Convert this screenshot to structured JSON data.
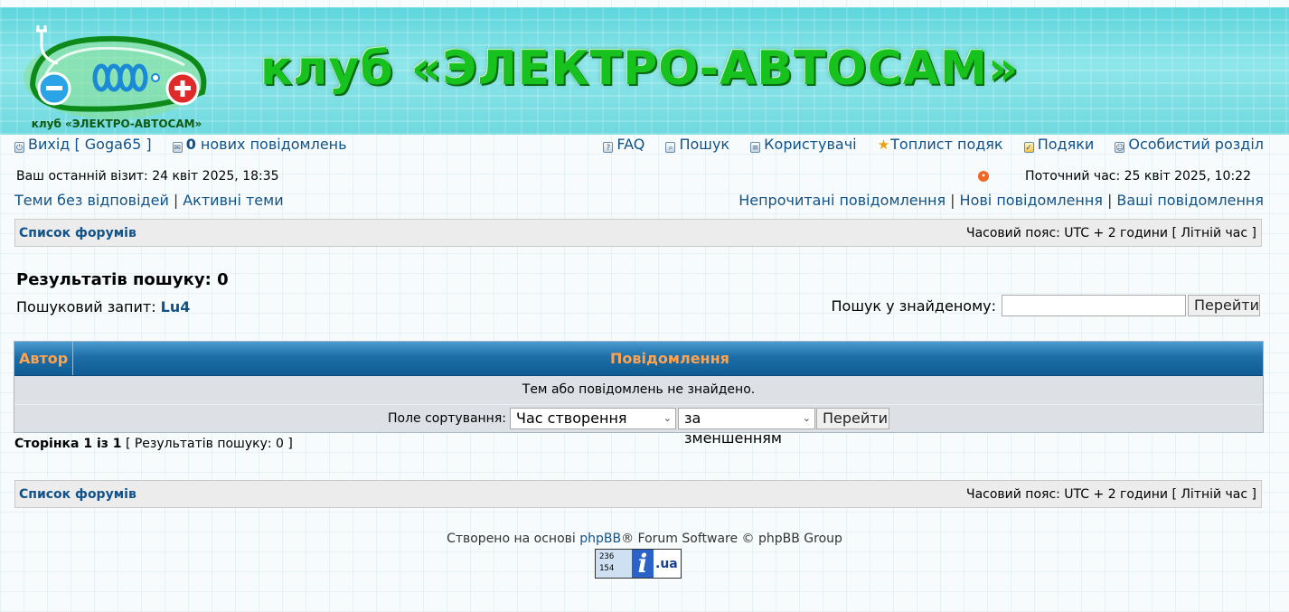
{
  "banner": {
    "logo_caption": "клуб «ЭЛЕКТРО-АВТОСАМ»",
    "title": "клуб «ЭЛЕКТРО-АВТОСАМ»"
  },
  "nav": {
    "logout_prefix": "Вихід [ ",
    "username": "Goga65",
    "logout_suffix": " ]",
    "new_count": "0",
    "new_label": " нових повідомлень",
    "faq": "FAQ",
    "search": "Пошук",
    "members": "Користувачі",
    "toplist": "Топлист подяк",
    "thanks": "Подяки",
    "ucp": "Особистий розділ"
  },
  "visit": {
    "last_visit": "Ваш останній візит: 24 квіт 2025, 18:35",
    "current_time": "Поточний час: 25 квіт 2025, 10:22"
  },
  "links": {
    "unanswered": "Теми без відповідей",
    "active": "Активні теми",
    "unread": "Непрочитані повідомлення",
    "new_posts": "Нові повідомлення",
    "your_posts": "Ваші повідомлення"
  },
  "breadcrumb": {
    "forum_index": "Список форумів",
    "timezone": "Часовий пояс: UTC + 2 години [ Літній час ]"
  },
  "search": {
    "results_title": "Результатів пошуку: 0",
    "query_label": "Пошуковий запит: ",
    "query": "Lu4",
    "within_label": "Пошук у знайденому:",
    "within_value": "",
    "go_label": "Перейти"
  },
  "table": {
    "col_author": "Автор",
    "col_message": "Повідомлення",
    "empty_text": "Тем або повідомлень не знайдено.",
    "sort_label": "Поле сортування:",
    "sort_field": "Час створення",
    "sort_dir": "за зменшенням",
    "sort_go": "Перейти"
  },
  "pagination": {
    "page_text": "Сторінка 1 із 1",
    "results_text": " [ Результатів пошуку: 0 ]"
  },
  "footer": {
    "prefix": "Створено на основі ",
    "phpbb": "phpBB",
    "suffix": "® Forum Software © phpBB Group",
    "counter_top": "236",
    "counter_bottom": "154",
    "counter_i": "i",
    "counter_ua": ".ua"
  },
  "colors": {
    "link": "#105289",
    "header_text": "#ffa34f",
    "banner_title": "#18c21e"
  }
}
